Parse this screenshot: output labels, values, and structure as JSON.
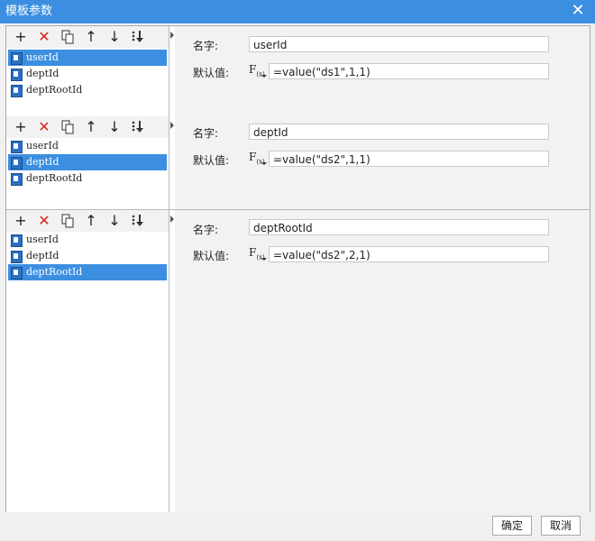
{
  "window": {
    "title": "模板参数",
    "close_glyph": "✕"
  },
  "toolbar": {
    "add_glyph": "+",
    "delete_glyph": "✕",
    "up_glyph": "↑",
    "down_glyph": "↓",
    "icons": [
      "plus-icon",
      "delete-icon",
      "copy-icon",
      "move-up-icon",
      "move-down-icon",
      "move-bottom-icon"
    ]
  },
  "labels": {
    "name": "名字:",
    "default": "默认值:",
    "fx": "F"
  },
  "sections": [
    {
      "items": [
        "userId",
        "deptId",
        "deptRootId"
      ],
      "selected": 0,
      "name_value": "userId",
      "default_value": "=value(\"ds1\",1,1)"
    },
    {
      "items": [
        "userId",
        "deptId",
        "deptRootId"
      ],
      "selected": 1,
      "name_value": "deptId",
      "default_value": "=value(\"ds2\",1,1)"
    },
    {
      "items": [
        "userId",
        "deptId",
        "deptRootId"
      ],
      "selected": 2,
      "name_value": "deptRootId",
      "default_value": "=value(\"ds2\",2,1)"
    }
  ],
  "buttons": {
    "ok": "确定",
    "cancel": "取消"
  },
  "colors": {
    "title_bg": "#3c8fe0",
    "selected_bg": "#3c8fe0",
    "delete_red": "#d9261c"
  }
}
